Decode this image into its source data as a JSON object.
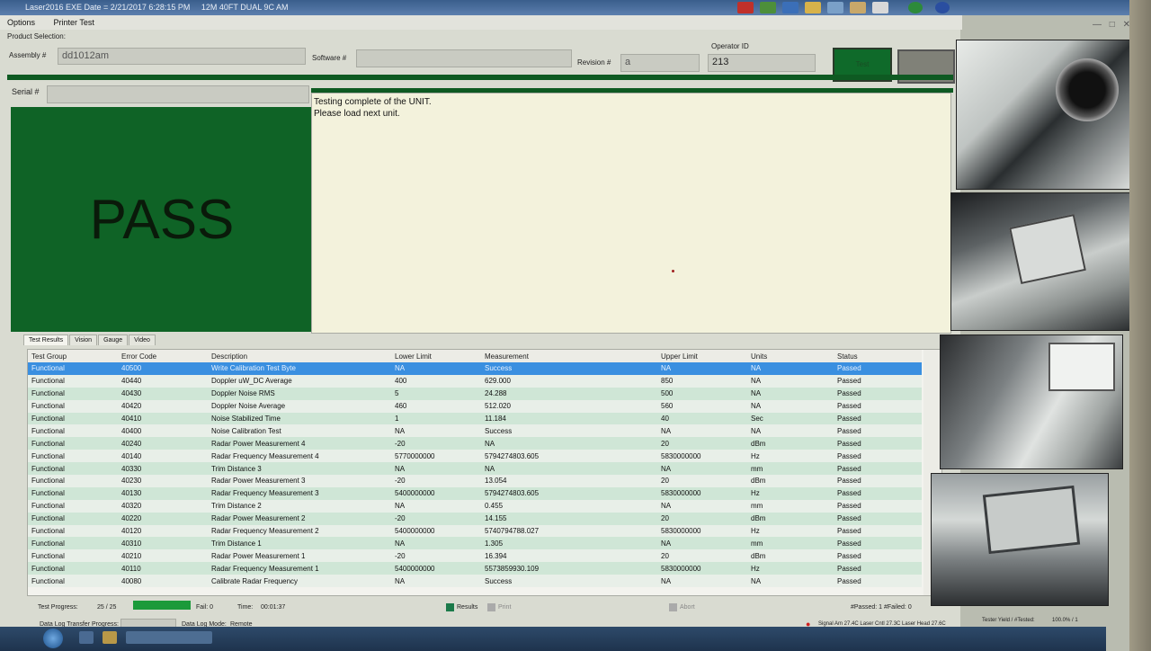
{
  "window": {
    "title_app": "Laser2016 EXE Date = 2/21/2017 6:28:15 PM",
    "title_model": "12M 40FT DUAL 9C AM"
  },
  "menu": {
    "options": "Options",
    "printer_test": "Printer Test"
  },
  "form": {
    "product_selection": "Product Selection:",
    "assembly_label": "Assembly #",
    "assembly_value": "dd1012am",
    "software_label": "Software #",
    "software_value": "",
    "revision_label": "Revision #",
    "revision_value": "a",
    "operator_label": "Operator ID",
    "operator_value": "213",
    "serial_label": "Serial #",
    "serial_value": "",
    "test_button": "Test"
  },
  "result": {
    "verdict": "PASS",
    "message_line1": "Testing complete of the UNIT.",
    "message_line2": "Please load next unit."
  },
  "tabs": [
    "Test Results",
    "Vision",
    "Gauge",
    "Video"
  ],
  "table": {
    "columns": [
      "Test Group",
      "Error Code",
      "Description",
      "Lower Limit",
      "Measurement",
      "Upper Limit",
      "Units",
      "Status"
    ],
    "rows": [
      [
        "Functional",
        "40500",
        "Write Calibration Test Byte",
        "NA",
        "Success",
        "NA",
        "NA",
        "Passed"
      ],
      [
        "Functional",
        "40440",
        "Doppler uW_DC Average",
        "400",
        "629.000",
        "850",
        "NA",
        "Passed"
      ],
      [
        "Functional",
        "40430",
        "Doppler Noise RMS",
        "5",
        "24.288",
        "500",
        "NA",
        "Passed"
      ],
      [
        "Functional",
        "40420",
        "Doppler Noise Average",
        "460",
        "512.020",
        "560",
        "NA",
        "Passed"
      ],
      [
        "Functional",
        "40410",
        "Noise Stabilized Time",
        "1",
        "11.184",
        "40",
        "Sec",
        "Passed"
      ],
      [
        "Functional",
        "40400",
        "Noise Calibration Test",
        "NA",
        "Success",
        "NA",
        "NA",
        "Passed"
      ],
      [
        "Functional",
        "40240",
        "Radar Power Measurement 4",
        "-20",
        "NA",
        "20",
        "dBm",
        "Passed"
      ],
      [
        "Functional",
        "40140",
        "Radar Frequency Measurement 4",
        "5770000000",
        "5794274803.605",
        "5830000000",
        "Hz",
        "Passed"
      ],
      [
        "Functional",
        "40330",
        "Trim Distance 3",
        "NA",
        "NA",
        "NA",
        "mm",
        "Passed"
      ],
      [
        "Functional",
        "40230",
        "Radar Power Measurement 3",
        "-20",
        "13.054",
        "20",
        "dBm",
        "Passed"
      ],
      [
        "Functional",
        "40130",
        "Radar Frequency Measurement 3",
        "5400000000",
        "5794274803.605",
        "5830000000",
        "Hz",
        "Passed"
      ],
      [
        "Functional",
        "40320",
        "Trim Distance 2",
        "NA",
        "0.455",
        "NA",
        "mm",
        "Passed"
      ],
      [
        "Functional",
        "40220",
        "Radar Power Measurement 2",
        "-20",
        "14.155",
        "20",
        "dBm",
        "Passed"
      ],
      [
        "Functional",
        "40120",
        "Radar Frequency Measurement 2",
        "5400000000",
        "5740794788.027",
        "5830000000",
        "Hz",
        "Passed"
      ],
      [
        "Functional",
        "40310",
        "Trim Distance 1",
        "NA",
        "1.305",
        "NA",
        "mm",
        "Passed"
      ],
      [
        "Functional",
        "40210",
        "Radar Power Measurement 1",
        "-20",
        "16.394",
        "20",
        "dBm",
        "Passed"
      ],
      [
        "Functional",
        "40110",
        "Radar Frequency Measurement 1",
        "5400000000",
        "5573859930.109",
        "5830000000",
        "Hz",
        "Passed"
      ],
      [
        "Functional",
        "40080",
        "Calibrate Radar Frequency",
        "NA",
        "Success",
        "NA",
        "NA",
        "Passed"
      ]
    ]
  },
  "statusbar": {
    "progress_label": "Test Progress:",
    "progress_value": "25 / 25",
    "progress_fraction": 1.0,
    "fail_label": "Fail: 0",
    "time_label": "Time:",
    "time_value": "00:01:37",
    "results_label": "Results",
    "print_label": "Print",
    "abort_label": "Abort",
    "passed_failed": "#Passed: 1  #Failed: 0",
    "datalog_label": "Data Log Transfer Progress:",
    "datalog_mode_label": "Data Log Mode:",
    "datalog_mode_value": "Remote",
    "signals": "Signal Am 27.4C  Laser Cntl 27.3C  Laser Head 27.6C",
    "yield_label": "Tester Yield / #Tested:",
    "yield_value": "100.0% / 1"
  },
  "colors": {
    "pass_green": "#0f6326",
    "selected_row": "#3a8fe0",
    "row_tint": "#cfe6d6",
    "message_bg": "#f3f2dc"
  }
}
